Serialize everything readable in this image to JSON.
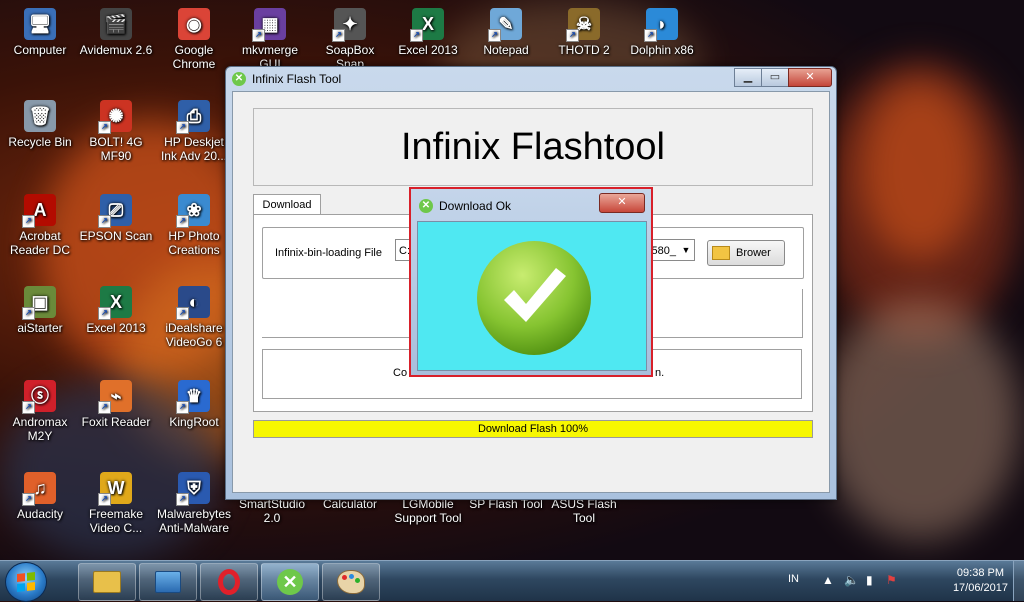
{
  "desktop": {
    "icons": [
      {
        "label": "Computer",
        "glyph": "🖥",
        "color": "#3a6fb8",
        "shortcut": false
      },
      {
        "label": "Avidemux 2.6",
        "glyph": "🎬",
        "color": "#444444",
        "shortcut": false
      },
      {
        "label": "Google Chrome",
        "glyph": "◉",
        "color": "#db4437",
        "shortcut": false
      },
      {
        "label": "mkvmerge GUI",
        "glyph": "▦",
        "color": "#6a3fa0",
        "shortcut": true
      },
      {
        "label": "SoapBox Snap",
        "glyph": "✦",
        "color": "#555555",
        "shortcut": true
      },
      {
        "label": "Excel 2013",
        "glyph": "X",
        "color": "#1d7a45",
        "shortcut": true
      },
      {
        "label": "Notepad",
        "glyph": "✎",
        "color": "#6fa8d8",
        "shortcut": true
      },
      {
        "label": "THOTD 2",
        "glyph": "☠",
        "color": "#8a6a2a",
        "shortcut": true
      },
      {
        "label": "Dolphin x86",
        "glyph": "◗",
        "color": "#2b8ad8",
        "shortcut": true
      },
      {
        "label": "Recycle Bin",
        "glyph": "🗑",
        "color": "#8899aa",
        "shortcut": false
      },
      {
        "label": "BOLT! 4G MF90",
        "glyph": "✺",
        "color": "#cc3322",
        "shortcut": true
      },
      {
        "label": "HP Deskjet Ink Adv 20...",
        "glyph": "⎙",
        "color": "#2f5fa8",
        "shortcut": true
      },
      {
        "label": "Acrobat Reader DC",
        "glyph": "A",
        "color": "#b30b00",
        "shortcut": true
      },
      {
        "label": "EPSON Scan",
        "glyph": "⎚",
        "color": "#2f5fa8",
        "shortcut": true
      },
      {
        "label": "HP Photo Creations",
        "glyph": "❀",
        "color": "#3a8ad0",
        "shortcut": true
      },
      {
        "label": "aiStarter",
        "glyph": "▣",
        "color": "#6a8a3a",
        "shortcut": true
      },
      {
        "label": "Excel 2013",
        "glyph": "X",
        "color": "#1d7a45",
        "shortcut": true
      },
      {
        "label": "iDealshare VideoGo 6",
        "glyph": "◐",
        "color": "#2a4a8a",
        "shortcut": true
      },
      {
        "label": "Andromax M2Y",
        "glyph": "ⓢ",
        "color": "#d0202a",
        "shortcut": true
      },
      {
        "label": "Foxit Reader",
        "glyph": "⌁",
        "color": "#e0702a",
        "shortcut": true
      },
      {
        "label": "KingRoot",
        "glyph": "♛",
        "color": "#2a6ad0",
        "shortcut": true
      },
      {
        "label": "Audacity",
        "glyph": "♫",
        "color": "#e0602a",
        "shortcut": true
      },
      {
        "label": "Freemake Video C...",
        "glyph": "W",
        "color": "#e0a81a",
        "shortcut": true
      },
      {
        "label": "Malwarebytes Anti-Malware",
        "glyph": "⛨",
        "color": "#2a5ab0",
        "shortcut": true
      },
      {
        "label": "SmartStudio 2.0",
        "glyph": "",
        "color": "transparent",
        "shortcut": false
      },
      {
        "label": "Calculator",
        "glyph": "",
        "color": "transparent",
        "shortcut": false
      },
      {
        "label": "LGMobile Support Tool",
        "glyph": "",
        "color": "transparent",
        "shortcut": false
      },
      {
        "label": "SP Flash Tool",
        "glyph": "",
        "color": "transparent",
        "shortcut": false
      },
      {
        "label": "ASUS Flash Tool",
        "glyph": "",
        "color": "transparent",
        "shortcut": false
      }
    ]
  },
  "window": {
    "title": "Infinix Flash Tool",
    "banner": "Infinix Flashtool",
    "tab_label": "Download",
    "file_label": "Infinix-bin-loading File",
    "file_path_start": "C:",
    "file_path_end": "580_",
    "browse_label": "Brower",
    "message_start": "Co",
    "message_end": "n.",
    "progress_text": "Download Flash 100%",
    "progress_percent": 100,
    "progress_color": "#f7f700",
    "minimize_glyph": "▁",
    "maximize_glyph": "▭",
    "close_glyph": "✕"
  },
  "dialog": {
    "title": "Download Ok",
    "close_glyph": "✕",
    "border_color": "#d8202a",
    "body_color": "#4fe8f2",
    "check_color": "#8cc63f"
  },
  "taskbar": {
    "apps": [
      "file-explorer",
      "control-panel",
      "opera",
      "infinix-flash-tool",
      "paint"
    ],
    "language": "IN",
    "time": "09:38 PM",
    "date": "17/06/2017"
  }
}
